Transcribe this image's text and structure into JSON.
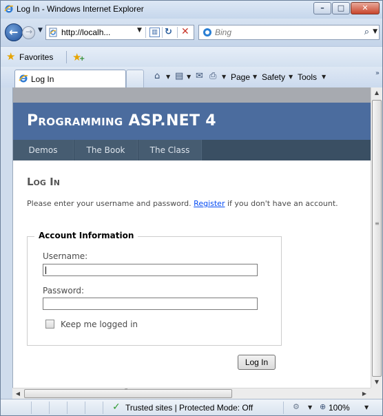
{
  "window": {
    "title": "Log In - Windows Internet Explorer",
    "minimize_glyph": "–",
    "maximize_glyph": "□",
    "close_glyph": "✕"
  },
  "nav": {
    "back_glyph": "←",
    "forward_glyph": "→",
    "dropdown_glyph": "▼"
  },
  "address": {
    "url": "http://localh...",
    "dropdown_glyph": "▼",
    "refresh_glyph": "↻",
    "stop_glyph": "✕"
  },
  "search": {
    "placeholder": "Bing",
    "go_glyph": "⌕",
    "dropdown_glyph": "▼"
  },
  "favorites": {
    "label": "Favorites",
    "star_glyph": "★"
  },
  "tab": {
    "label": "Log In"
  },
  "commands": {
    "home_glyph": "⌂",
    "feeds_glyph": "▤",
    "mail_glyph": "✉",
    "print_glyph": "⎙",
    "dropdown_glyph": "▼",
    "page": "Page",
    "safety": "Safety",
    "tools": "Tools",
    "chevron": "»"
  },
  "site": {
    "title": "Programming ASP.NET 4",
    "nav": [
      "Demos",
      "The Book",
      "The Class"
    ],
    "heading": "Log In",
    "intro_before": "Please enter your username and password. ",
    "intro_link": "Register",
    "intro_after": " if you don't have an account.",
    "fieldset_legend": "Account Information",
    "username_label": "Username:",
    "username_value": "",
    "password_label": "Password:",
    "password_value": "",
    "remember_label": "Keep me logged in",
    "remember_checked": false,
    "submit_label": "Log In"
  },
  "scrollbar": {
    "up_glyph": "▲",
    "down_glyph": "▼",
    "left_glyph": "◀",
    "right_glyph": "▶",
    "grip_glyph": "≡",
    "hgrip_glyph": "‴"
  },
  "status": {
    "check_glyph": "✓",
    "text": "Trusted sites | Protected Mode: Off",
    "zone_glyph": "⚙",
    "zoom_glyph": "⊕",
    "zoom": "100%",
    "dropdown_glyph": "▼"
  }
}
